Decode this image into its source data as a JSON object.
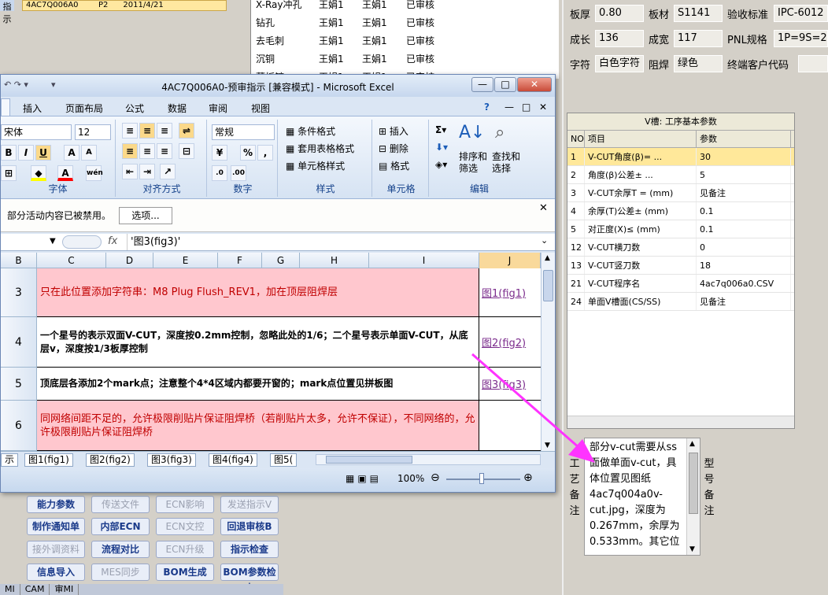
{
  "background": {
    "left_strip": "指示",
    "top_row": "4AC7Q006A0        P2      2011/4/21",
    "process_rows": [
      {
        "name": "X-Ray冲孔",
        "person": "王娟1",
        "checker": "王娟1",
        "status": "已审核"
      },
      {
        "name": "钻孔",
        "person": "王娟1",
        "checker": "王娟1",
        "status": "已审核"
      },
      {
        "name": "去毛刺",
        "person": "王娟1",
        "checker": "王娟1",
        "status": "已审核"
      },
      {
        "name": "沉铜",
        "person": "王娟1",
        "checker": "王娟1",
        "status": "已审核"
      },
      {
        "name": "薄板镀",
        "person": "王娟1",
        "checker": "王娟1",
        "status": "已审核"
      }
    ]
  },
  "params": {
    "thickness_label": "板厚",
    "thickness": "0.80",
    "material_label": "板材",
    "material": "S1141",
    "standard_label": "验收标准",
    "standard": "IPC-6012",
    "length_label": "成长",
    "length": "136",
    "width_label": "成宽",
    "width": "117",
    "pnl_label": "PNL规格",
    "pnl": "1P=9S=20",
    "char_label": "字符",
    "char": "白色字符",
    "mask_label": "阻焊",
    "mask": "绿色",
    "customer_label": "终端客户代码",
    "customer": ""
  },
  "vgroove": {
    "title": "V槽: 工序基本参数",
    "col_no": "NO",
    "col_item": "项目",
    "col_param": "参数",
    "rows": [
      {
        "no": "1",
        "item": "V-CUT角度(β)=  ...",
        "param": "30"
      },
      {
        "no": "2",
        "item": "角度(β)公差±  ...",
        "param": "5"
      },
      {
        "no": "3",
        "item": "V-CUT余厚T = (mm)",
        "param": "见备注"
      },
      {
        "no": "4",
        "item": "余厚(T)公差± (mm)",
        "param": "0.1"
      },
      {
        "no": "5",
        "item": "对正度(X)≤ (mm)",
        "param": "0.1"
      },
      {
        "no": "12",
        "item": "V-CUT横刀数",
        "param": "0"
      },
      {
        "no": "13",
        "item": "V-CUT竖刀数",
        "param": "18"
      },
      {
        "no": "21",
        "item": "V-CUT程序名",
        "param": "4ac7q006a0.CSV"
      },
      {
        "no": "24",
        "item": "单面V槽面(CS/SS)",
        "param": "见备注"
      }
    ]
  },
  "remarks": {
    "label": "工艺备注",
    "text": "部分v-cut需要从ss面做单面v-cut，具体位置见图纸4ac7q004a0v-cut.jpg，深度为0.267mm，余厚为0.533mm。其它位",
    "model_label": "型号备注"
  },
  "buttons": [
    {
      "label": "能力参数",
      "enabled": true
    },
    {
      "label": "传送文件",
      "enabled": false
    },
    {
      "label": "ECN影响",
      "enabled": false
    },
    {
      "label": "发送指示V",
      "enabled": false
    },
    {
      "label": "制作通知单",
      "enabled": true
    },
    {
      "label": "内部ECN",
      "enabled": true
    },
    {
      "label": "ECN文控",
      "enabled": false
    },
    {
      "label": "回退审核B",
      "enabled": true
    },
    {
      "label": "接外调资料",
      "enabled": false
    },
    {
      "label": "流程对比",
      "enabled": true
    },
    {
      "label": "ECN升级",
      "enabled": false
    },
    {
      "label": "指示检查",
      "enabled": true
    },
    {
      "label": "信息导入",
      "enabled": true
    },
    {
      "label": "MES同步",
      "enabled": false
    },
    {
      "label": "BOM生成",
      "enabled": true
    },
    {
      "label": "BOM参数检查",
      "enabled": true
    }
  ],
  "bottom_tabs": [
    "MI",
    "CAM",
    "审MI"
  ],
  "excel": {
    "title": "4AC7Q006A0-预审指示  [兼容模式] - Microsoft Excel",
    "tabs": [
      "插入",
      "页面布局",
      "公式",
      "数据",
      "审阅",
      "视图"
    ],
    "font_name": "宋体",
    "font_size": "12",
    "number_format": "常规",
    "groups": {
      "font": "字体",
      "align": "对齐方式",
      "number": "数字",
      "style": "样式",
      "cells": "单元格",
      "edit": "编辑"
    },
    "style_items": [
      "条件格式",
      "套用表格格式",
      "单元格样式"
    ],
    "cell_items": [
      "插入",
      "删除",
      "格式"
    ],
    "edit_items": [
      "排序和筛选",
      "查找和选择"
    ],
    "sort_l1": "排序和",
    "sort_l2": "筛选",
    "find_l1": "查找和",
    "find_l2": "选择",
    "msg": "部分活动内容已被禁用。",
    "options_btn": "选项...",
    "formula": "'图3(fig3)'",
    "columns": [
      "B",
      "C",
      "D",
      "E",
      "F",
      "G",
      "H",
      "I",
      "J"
    ],
    "rows": [
      {
        "n": "3",
        "text": "只在此位置添加字符串：M8 Plug Flush_REV1，加在顶层阻焊层",
        "link": "图1(fig1)"
      },
      {
        "n": "4",
        "text": "一个星号的表示双面V-CUT，深度按0.2mm控制，忽略此处的1/6；二个星号表示单面V-CUT，从底层v，深度按1/3板厚控制",
        "link": "图2(fig2)"
      },
      {
        "n": "5",
        "text": "顶底层各添加2个mark点；注意整个4*4区域内都要开窗的；mark点位置见拼板图",
        "link": "图3(fig3)"
      },
      {
        "n": "6",
        "text": "同网络间距不足的，允许极限削贴片保证阻焊桥（若削贴片太多，允许不保证），不同网络的，允许极限削贴片保证阻焊桥",
        "link": ""
      }
    ],
    "sheet_tabs": [
      "示",
      "图1(fig1)",
      "图2(fig2)",
      "图3(fig3)",
      "图4(fig4)",
      "图5("
    ],
    "zoom": "100%"
  }
}
